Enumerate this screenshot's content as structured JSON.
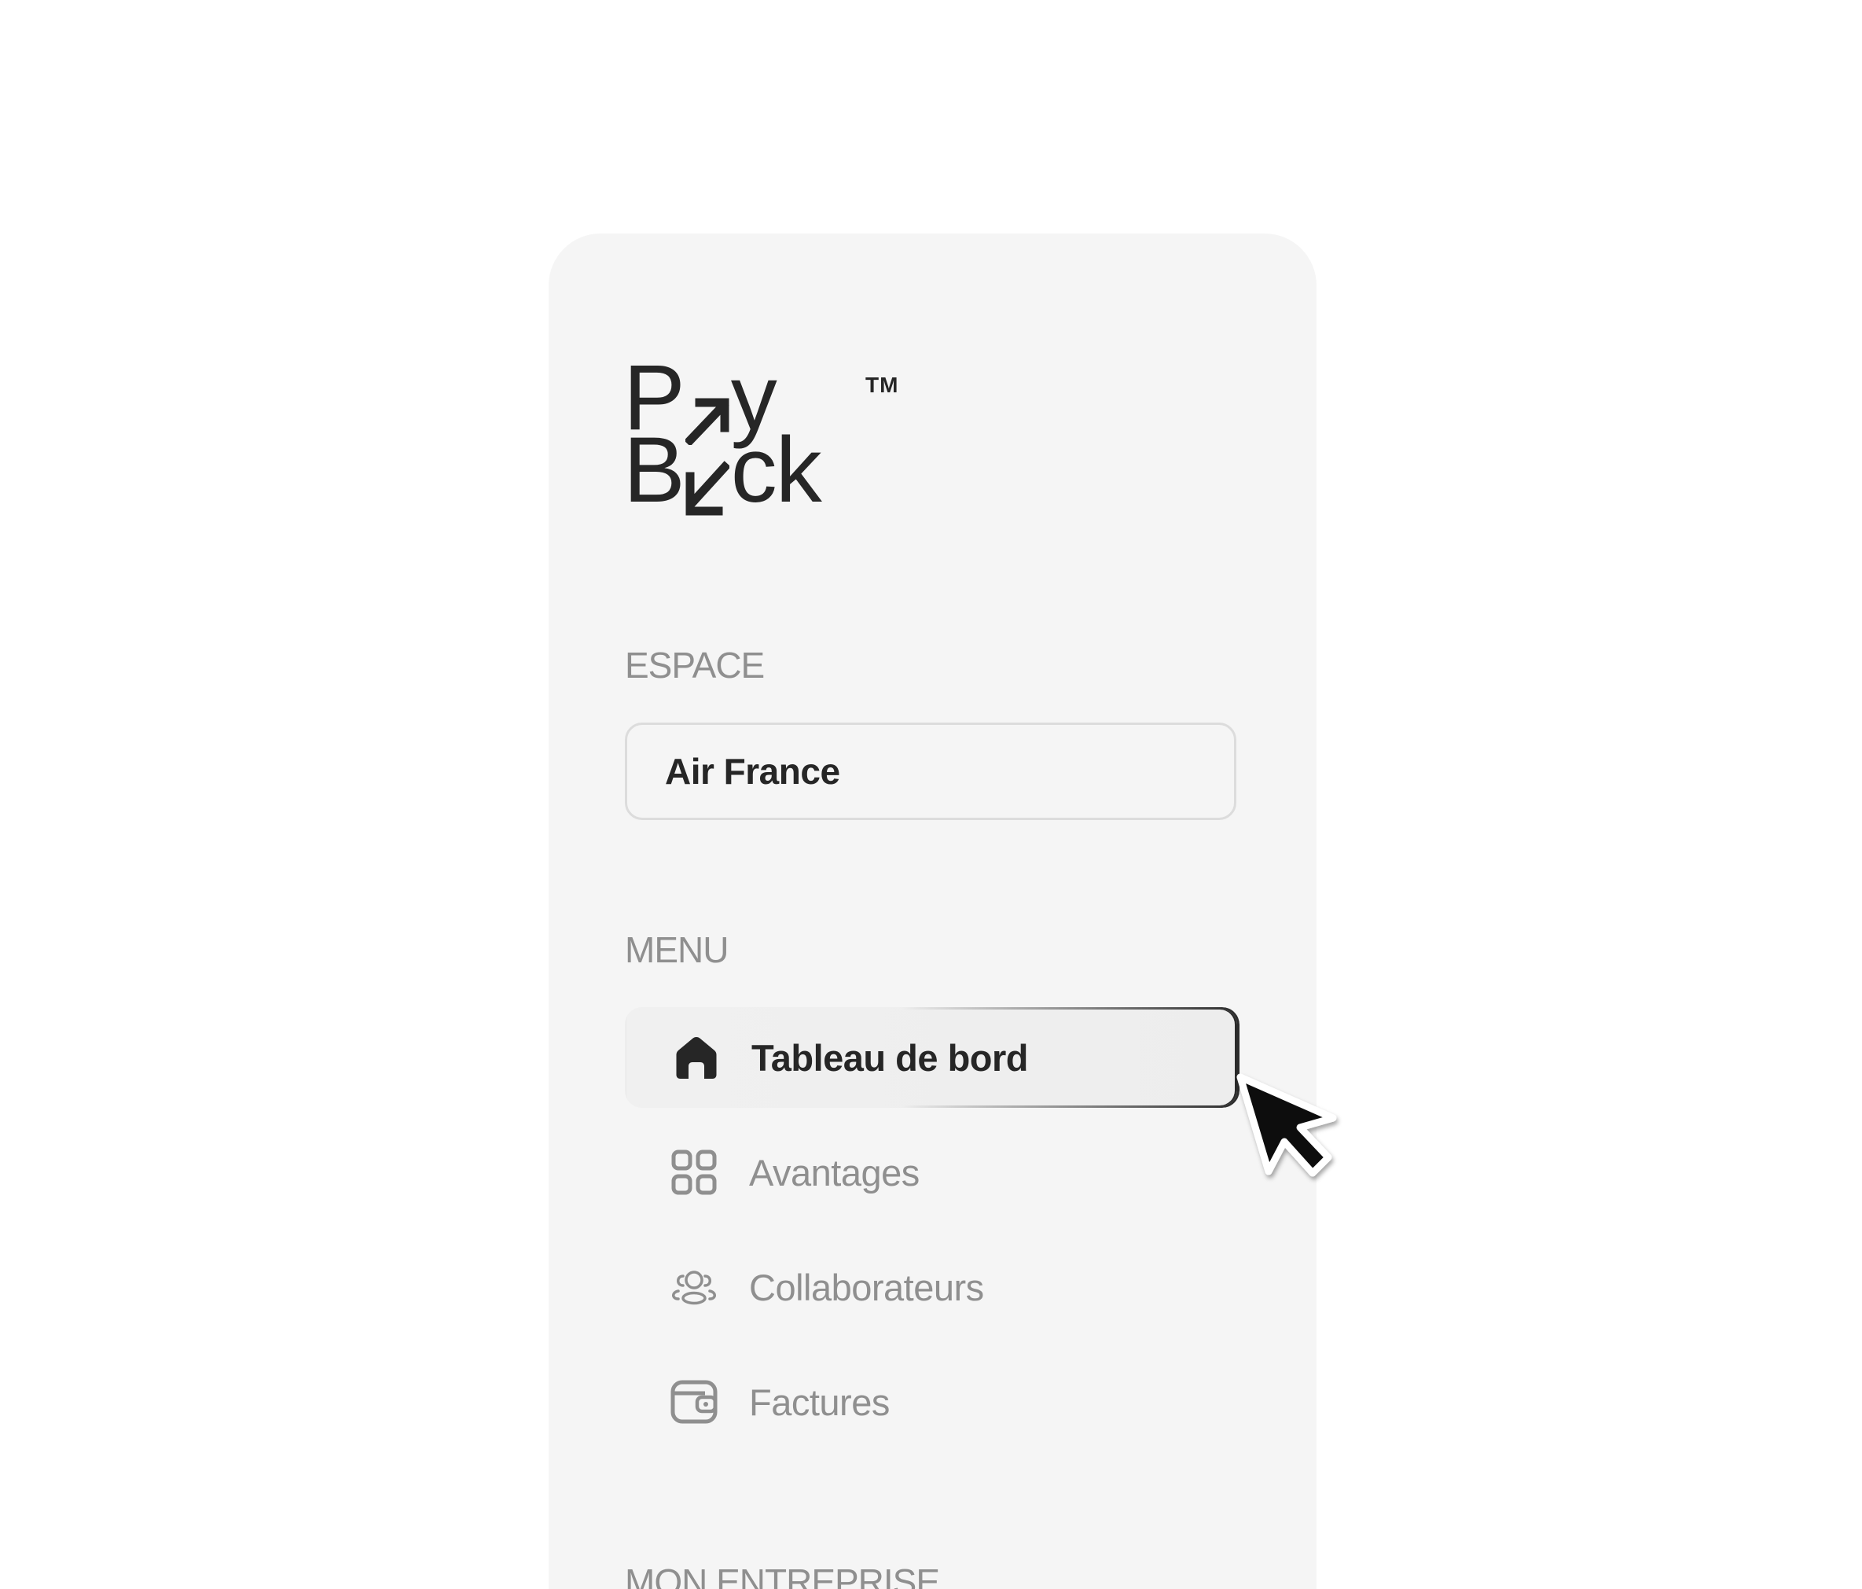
{
  "brand": {
    "line1_left": "P",
    "line1_right": "y",
    "line2_left": "B",
    "line2_right": "ck",
    "trademark": "TM"
  },
  "sections": {
    "space_label": "ESPACE",
    "menu_label": "MENU",
    "company_label": "MON ENTREPRISE"
  },
  "space": {
    "value": "Air France"
  },
  "menu": {
    "items": [
      {
        "label": "Tableau de bord",
        "icon": "home-icon",
        "active": true
      },
      {
        "label": "Avantages",
        "icon": "grid-icon",
        "active": false
      },
      {
        "label": "Collaborateurs",
        "icon": "users-icon",
        "active": false
      },
      {
        "label": "Factures",
        "icon": "wallet-icon",
        "active": false
      }
    ]
  },
  "colors": {
    "sidebar_bg": "#f5f5f5",
    "text_dark": "#262626",
    "text_muted": "#8f8f8f"
  }
}
